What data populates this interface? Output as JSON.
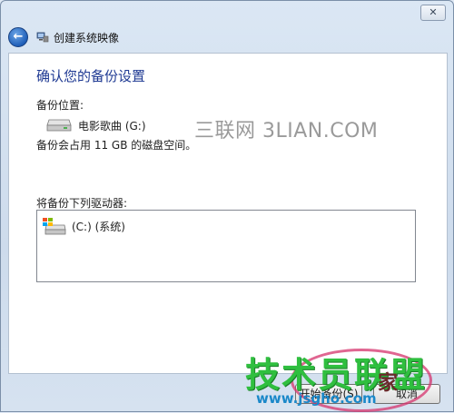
{
  "window": {
    "close_glyph": "✕"
  },
  "nav": {
    "back_glyph": "←",
    "title": "创建系统映像"
  },
  "content": {
    "heading": "确认您的备份设置",
    "location_label": "备份位置:",
    "drive_name": "电影歌曲 (G:)",
    "space_text": "备份会占用 11 GB 的磁盘空间。",
    "include_label": "将备份下列驱动器:",
    "drives": [
      {
        "label": "(C:) (系统)"
      }
    ]
  },
  "footer": {
    "start_label": "开始备份(S)",
    "cancel_label": "取消"
  },
  "watermarks": {
    "top": "三联网 3LIAN.COM",
    "logo_main": "技术员联盟",
    "logo_side": "家",
    "logo_url": "www.jsgho.com"
  },
  "colors": {
    "heading": "#1f3a93",
    "window_bg": "#cddbec",
    "watermark_green": "#2fbf3f",
    "watermark_blue": "#1a88c9"
  },
  "icons": {
    "back": "back-arrow-icon",
    "app": "system-image-icon",
    "drive": "hard-drive-icon",
    "system_drive": "windows-drive-icon",
    "close": "close-icon"
  }
}
